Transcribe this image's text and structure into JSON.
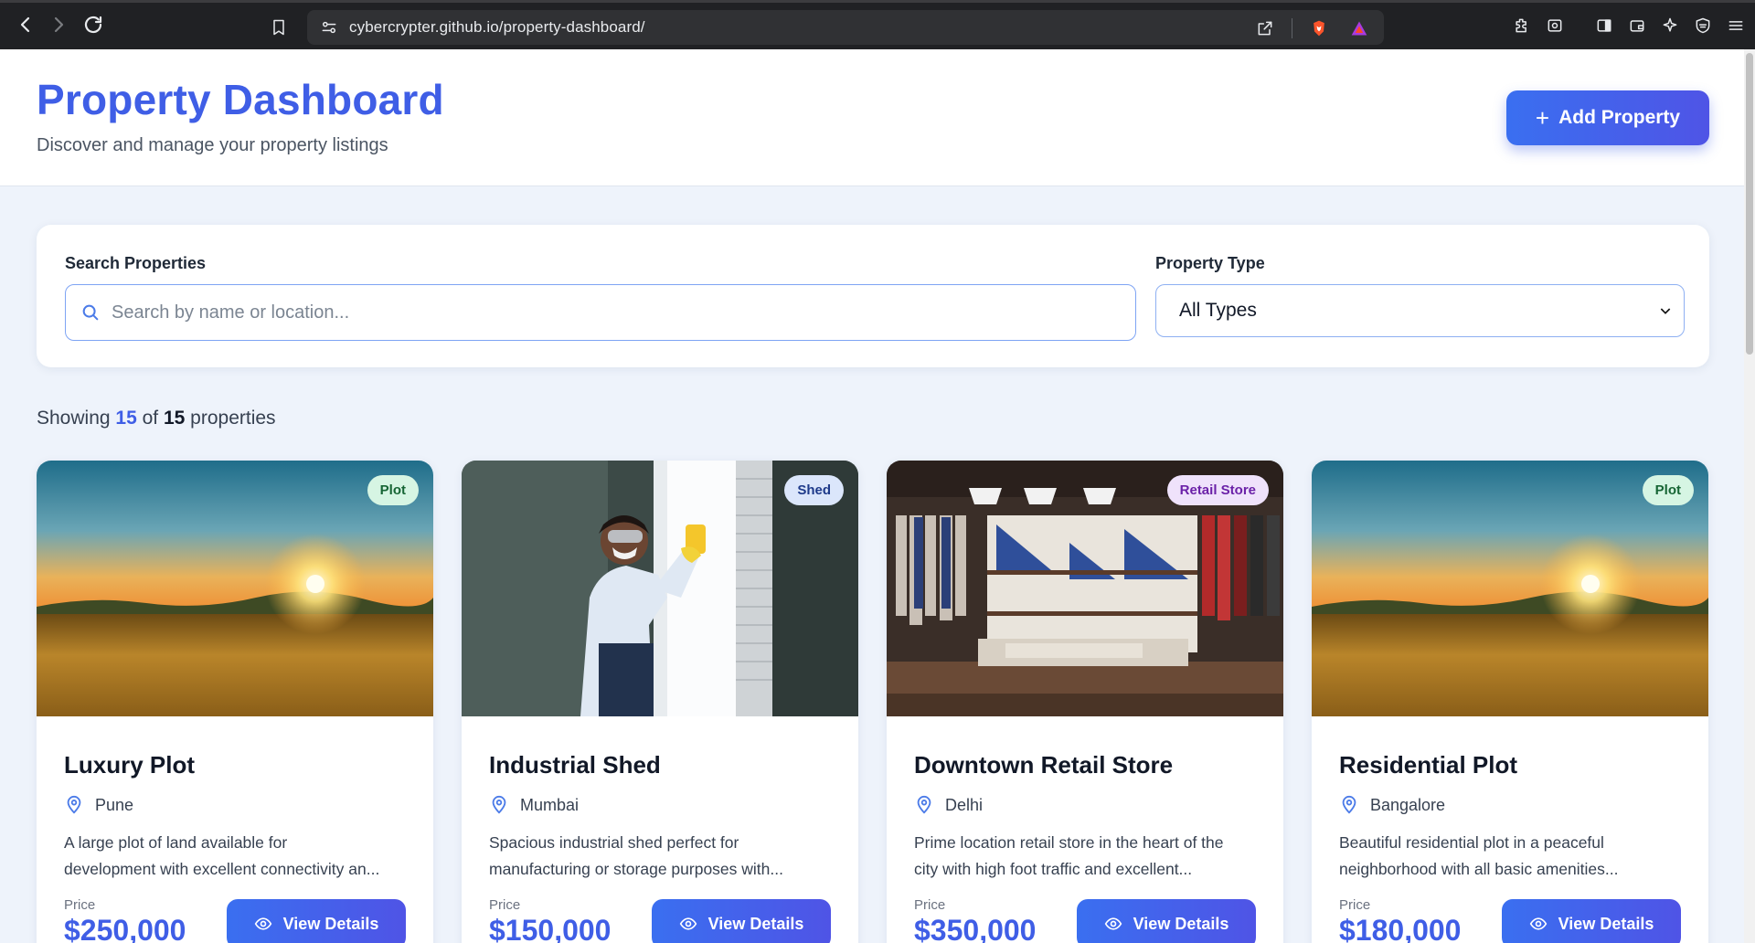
{
  "browser": {
    "url": "cybercrypter.github.io/property-dashboard/"
  },
  "header": {
    "title": "Property Dashboard",
    "subtitle": "Discover and manage your property listings",
    "add_button": "Add Property"
  },
  "filters": {
    "search_label": "Search Properties",
    "search_placeholder": "Search by name or location...",
    "type_label": "Property Type",
    "type_selected": "All Types"
  },
  "results": {
    "prefix": "Showing",
    "shown": "15",
    "middle": "of",
    "total": "15",
    "suffix": "properties"
  },
  "cards": [
    {
      "badge": "Plot",
      "badge_bg": "#d6f5e3",
      "badge_color": "#166534",
      "image": "sunset-field",
      "title": "Luxury Plot",
      "location": "Pune",
      "desc1": "A large plot of land available for",
      "desc2": "development with excellent connectivity an...",
      "price_label": "Price",
      "price": "$250,000",
      "button": "View Details"
    },
    {
      "badge": "Shed",
      "badge_bg": "#dbe6fb",
      "badge_color": "#1e3a8a",
      "image": "worker-window",
      "title": "Industrial Shed",
      "location": "Mumbai",
      "desc1": "Spacious industrial shed perfect for",
      "desc2": "manufacturing or storage purposes with...",
      "price_label": "Price",
      "price": "$150,000",
      "button": "View Details"
    },
    {
      "badge": "Retail Store",
      "badge_bg": "#efe2fb",
      "badge_color": "#6b21a8",
      "image": "clothing-store",
      "title": "Downtown Retail Store",
      "location": "Delhi",
      "desc1": "Prime location retail store in the heart of the",
      "desc2": "city with high foot traffic and excellent...",
      "price_label": "Price",
      "price": "$350,000",
      "button": "View Details"
    },
    {
      "badge": "Plot",
      "badge_bg": "#d6f5e3",
      "badge_color": "#166534",
      "image": "sunset-field",
      "title": "Residential Plot",
      "location": "Bangalore",
      "desc1": "Beautiful residential plot in a peaceful",
      "desc2": "neighborhood with all basic amenities...",
      "price_label": "Price",
      "price": "$180,000",
      "button": "View Details"
    }
  ]
}
